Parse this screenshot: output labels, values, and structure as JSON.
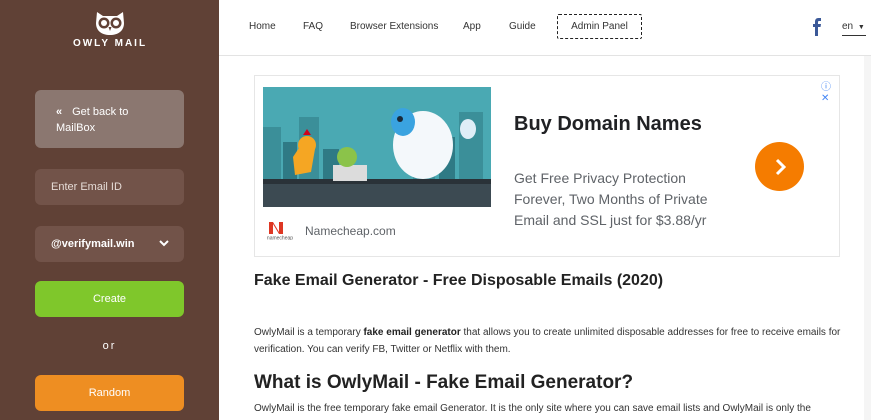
{
  "brand": {
    "name": "OWLY MAIL"
  },
  "sidebar": {
    "back_label_line1": "Get back to",
    "back_label_line2": "MailBox",
    "email_placeholder": "Enter Email ID",
    "domain_selected": "@verifymail.win",
    "create_label": "Create",
    "or_label": "or",
    "random_label": "Random"
  },
  "nav": {
    "items": [
      "Home",
      "FAQ",
      "Browser Extensions",
      "App",
      "Guide"
    ],
    "admin_label": "Admin Panel",
    "language": "en"
  },
  "ad": {
    "headline": "Buy Domain Names",
    "body": "Get Free Privacy Protection Forever, Two Months of Private Email and SSL just for $3.88/yr",
    "site": "Namecheap.com",
    "logo_text": "namecheap"
  },
  "content": {
    "title": "Fake Email Generator - Free Disposable Emails (2020)",
    "intro_before": "OwlyMail is a temporary ",
    "intro_bold": "fake email generator",
    "intro_after": " that allows you to create unlimited disposable addresses for free to receive emails for verification. You can verify FB, Twitter or Netflix with them.",
    "h2": "What is OwlyMail - Fake Email Generator?",
    "intro2": "OwlyMail is the free temporary fake email Generator. It is the only site where you can save email lists and OwlyMail is only the"
  },
  "colors": {
    "sidebar_bg": "#604136",
    "create_green": "#7fc72b",
    "random_orange": "#ee8e22",
    "ad_arrow": "#f57c00"
  }
}
